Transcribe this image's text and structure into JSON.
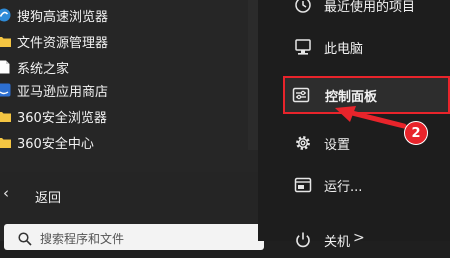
{
  "apps": [
    {
      "label": "搜狗高速浏览器",
      "icon": "sogou-browser-icon"
    },
    {
      "label": "文件资源管理器",
      "icon": "folder-icon"
    },
    {
      "label": "系统之家",
      "icon": "file-icon"
    },
    {
      "label": "亚马逊应用商店",
      "icon": "amazon-appstore-icon"
    },
    {
      "label": "360安全浏览器",
      "icon": "folder-icon"
    },
    {
      "label": "360安全中心",
      "icon": "folder-icon"
    }
  ],
  "back": {
    "label": "返回"
  },
  "search": {
    "placeholder": "搜索程序和文件"
  },
  "right_menu": {
    "recent": {
      "label": "最近使用的项目",
      "icon": "clock-icon"
    },
    "computer": {
      "label": "此电脑",
      "icon": "computer-icon"
    },
    "control_panel": {
      "label": "控制面板",
      "icon": "control-panel-icon"
    },
    "settings": {
      "label": "设置",
      "icon": "gear-icon"
    },
    "run": {
      "label": "运行...",
      "icon": "run-icon"
    },
    "shutdown": {
      "label": "关机",
      "icon": "power-icon",
      "chevron": ">"
    }
  },
  "annotation": {
    "step_number": "2"
  },
  "colors": {
    "highlight_border": "#e8242b",
    "folder": "#f4c542",
    "background": "#1f1f1f"
  }
}
